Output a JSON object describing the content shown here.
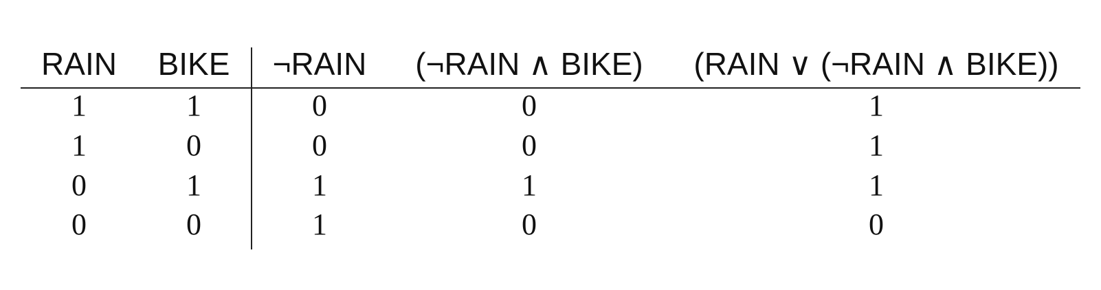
{
  "table": {
    "headers": [
      "RAIN",
      "BIKE",
      "¬RAIN",
      "(¬RAIN ∧ BIKE)",
      "(RAIN ∨ (¬RAIN ∧ BIKE))"
    ],
    "rows": [
      [
        "1",
        "1",
        "0",
        "0",
        "1"
      ],
      [
        "1",
        "0",
        "0",
        "0",
        "1"
      ],
      [
        "0",
        "1",
        "1",
        "1",
        "1"
      ],
      [
        "0",
        "0",
        "1",
        "0",
        "0"
      ]
    ]
  }
}
